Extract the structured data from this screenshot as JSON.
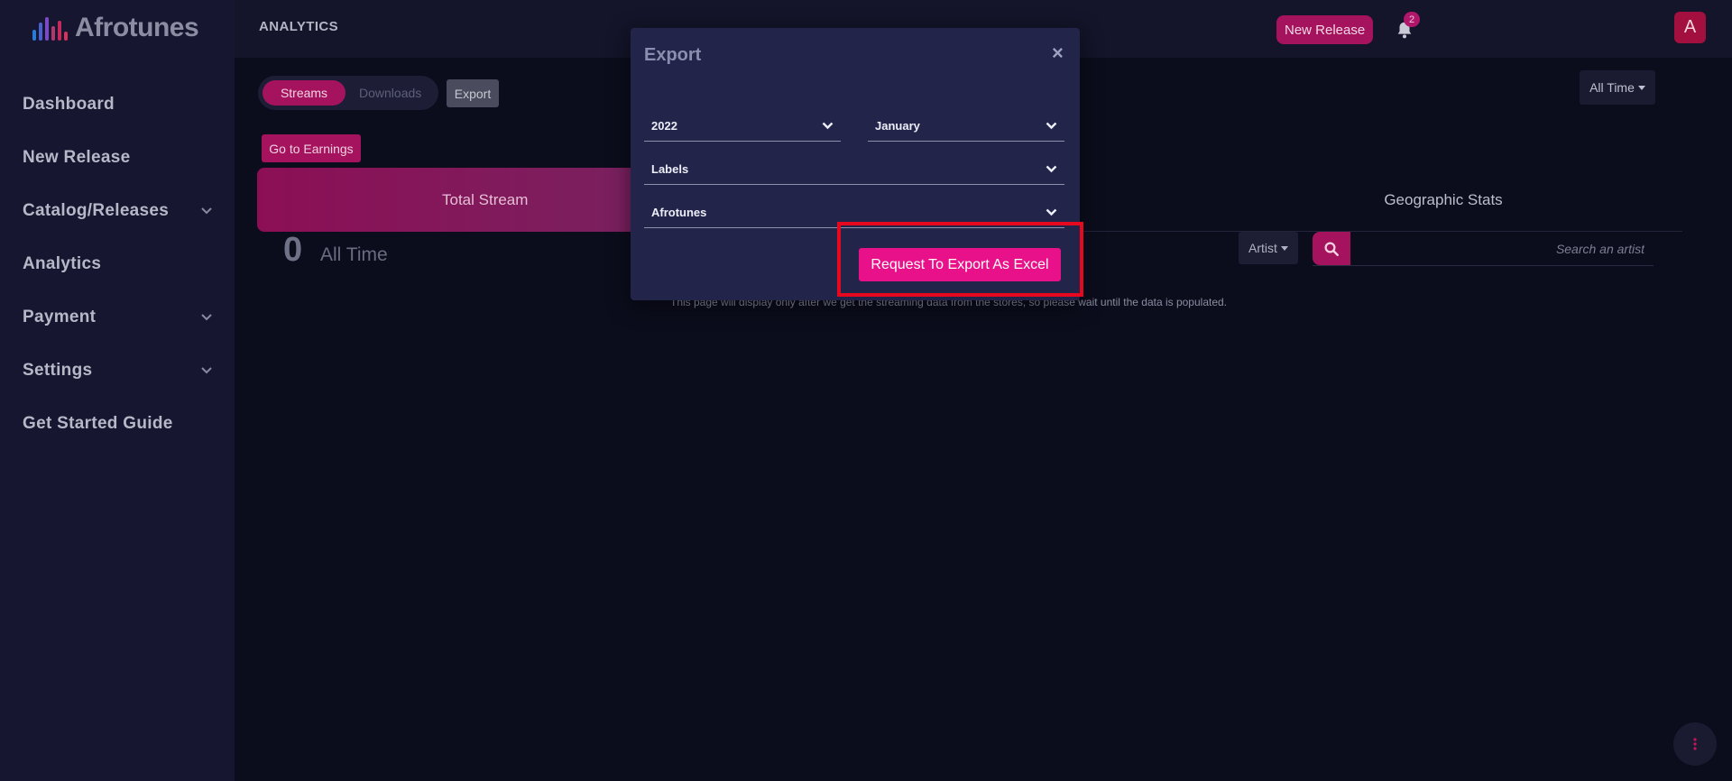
{
  "app": {
    "logo_text": "Afrotunes",
    "page_title": "ANALYTICS"
  },
  "sidebar": {
    "items": [
      {
        "label": "Dashboard",
        "has_submenu": false
      },
      {
        "label": "New Release",
        "has_submenu": false
      },
      {
        "label": "Catalog/Releases",
        "has_submenu": true
      },
      {
        "label": "Analytics",
        "has_submenu": false
      },
      {
        "label": "Payment",
        "has_submenu": true
      },
      {
        "label": "Settings",
        "has_submenu": true
      },
      {
        "label": "Get Started Guide",
        "has_submenu": false
      }
    ]
  },
  "header": {
    "new_release_label": "New Release",
    "notification_count": "2",
    "avatar_initial": "A"
  },
  "main": {
    "toggle": {
      "streams_label": "Streams",
      "downloads_label": "Downloads"
    },
    "export_label": "Export",
    "earnings_label": "Go to Earnings",
    "period_label": "All Time",
    "tabs": {
      "total_stream": "Total Stream",
      "geographic_stats": "Geographic Stats"
    },
    "stat": {
      "value": "0",
      "label": "All Time"
    },
    "artist_filter_label": "Artist",
    "search_placeholder": "Search an artist",
    "notice": "This page will display only after we get the streaming data from the stores, so please wait until the data is populated."
  },
  "modal": {
    "title": "Export",
    "close_symbol": "×",
    "year": "2022",
    "month": "January",
    "type": "Labels",
    "label_name": "Afrotunes",
    "request_button": "Request To Export As Excel"
  },
  "colors": {
    "accent": "#a5135e",
    "accent_bright": "#e8118a",
    "highlight": "#e5081f",
    "background": "#0b0d1c",
    "sidebar": "#161630"
  }
}
